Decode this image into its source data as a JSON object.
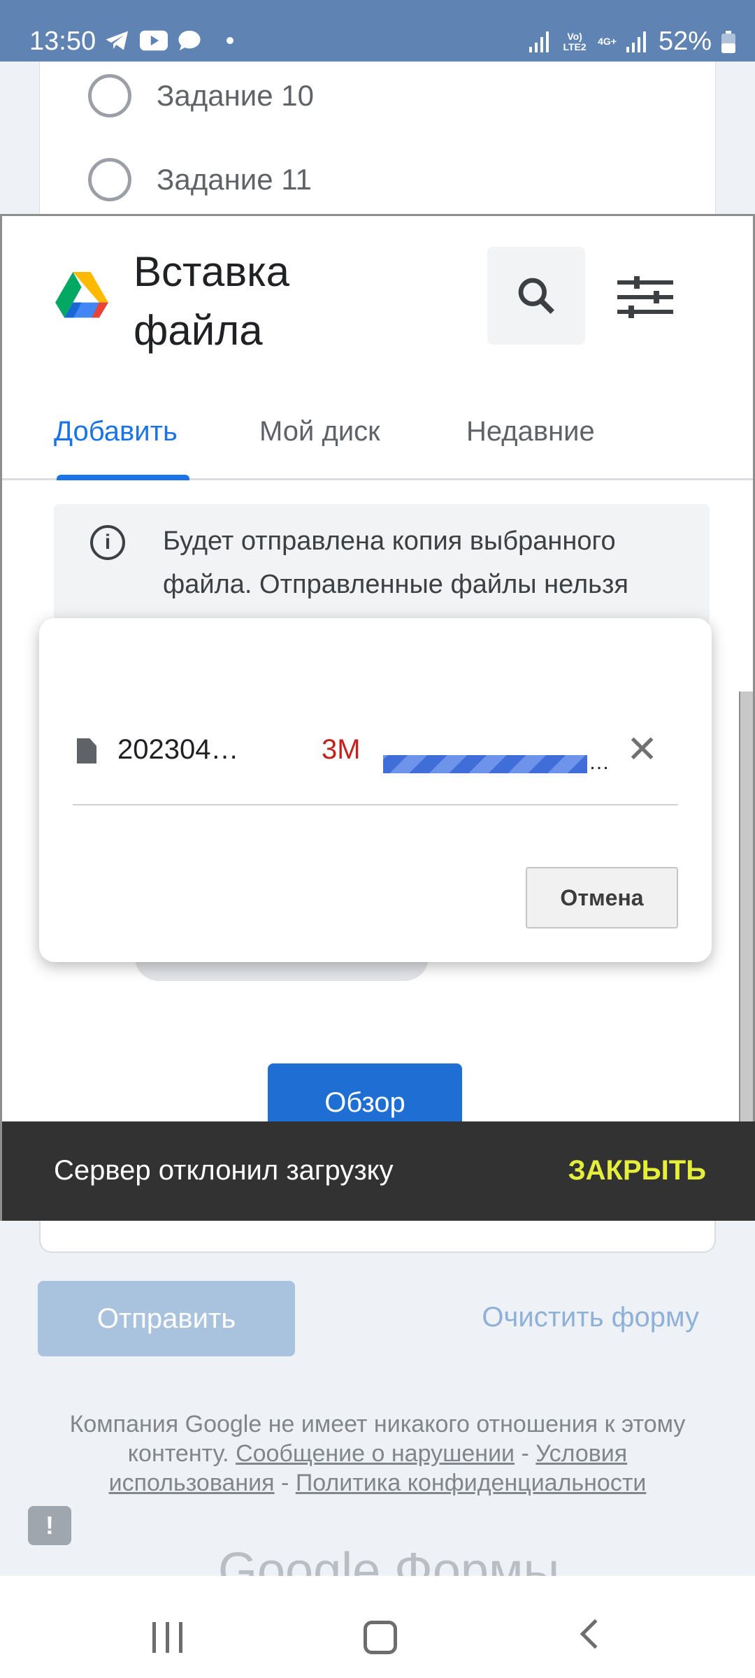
{
  "status_bar": {
    "time": "13:50",
    "volte_tag": "Vo) LTE2",
    "network_tag": "4G+",
    "battery": "52%"
  },
  "form": {
    "options": [
      {
        "label": "Задание 10"
      },
      {
        "label": "Задание 11"
      }
    ],
    "submit_label": "Отправить",
    "clear_label": "Очистить форму",
    "disclaimer_text": "Компания Google не имеет никакого отношения к этому контенту.",
    "report_link": "Сообщение о нарушении",
    "terms_link": "Условия использования",
    "privacy_link": "Политика конфиденциальности",
    "separator": " - ",
    "brand_text": "Google Формы"
  },
  "picker": {
    "title": "Вставка файла",
    "tabs": [
      {
        "label": "Добавить",
        "active": true
      },
      {
        "label": "Мой диск",
        "active": false
      },
      {
        "label": "Недавние",
        "active": false
      }
    ],
    "info_text": "Будет отправлена копия выбранного файла. Отправленные файлы нельзя изменить или удалить.",
    "browse_label": "Обзор"
  },
  "upload": {
    "file_name": "202304…",
    "file_size": "3M",
    "progress_ellipsis": "…",
    "cancel_label": "Отмена",
    "size_color": "#c5221f"
  },
  "snackbar": {
    "message": "Сервер отклонил загрузку",
    "action": "ЗАКРЫТЬ",
    "action_color": "#e5ef3b"
  },
  "icons": {
    "telegram": "telegram-icon",
    "youtube": "youtube-icon",
    "messages": "messages-icon",
    "search": "search-icon",
    "filter": "tune-icon",
    "info": "info-icon",
    "file": "file-icon",
    "close": "close-icon"
  }
}
